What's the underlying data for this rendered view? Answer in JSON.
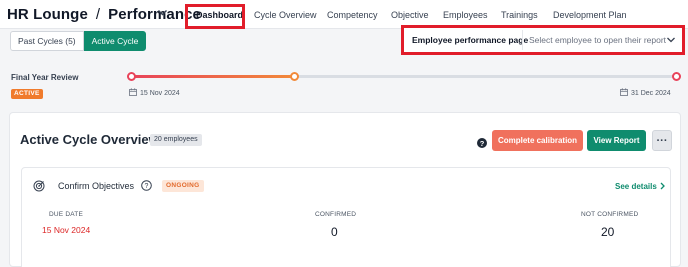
{
  "header": {
    "app": "HR Lounge",
    "section": "Performance",
    "tabs": [
      {
        "label": "Dashboard",
        "active": true
      },
      {
        "label": "Cycle Overview"
      },
      {
        "label": "Competency"
      },
      {
        "label": "Objective"
      },
      {
        "label": "Employees"
      },
      {
        "label": "Trainings"
      },
      {
        "label": "Development Plan"
      }
    ]
  },
  "cycle_toggle": {
    "past": "Past Cycles (5)",
    "active": "Active Cycle"
  },
  "report": {
    "label": "Employee performance page",
    "placeholder": "Select employee to open their report"
  },
  "timeline": {
    "label": "Final Year Review",
    "status": "ACTIVE",
    "start_date": "15 Nov 2024",
    "end_date": "31 Dec 2024",
    "progress": 0.3
  },
  "overview": {
    "title": "Active Cycle Overview",
    "employee_count": "20 employees",
    "calibration_button": "Complete calibration",
    "view_report_button": "View Report",
    "more_button": "···"
  },
  "objectives": {
    "title": "Confirm Objectives",
    "status": "ONGOING",
    "see_details": "See details",
    "due_date_label": "DUE DATE",
    "due_date": "15 Nov 2024",
    "confirmed_label": "CONFIRMED",
    "confirmed": "0",
    "not_confirmed_label": "NOT CONFIRMED",
    "not_confirmed": "20"
  },
  "colors": {
    "primary": "#0f8c6e",
    "accent_orange": "#f0715d",
    "highlight_box": "#e11d2a",
    "timeline_start": "#e8435a",
    "timeline_mid": "#f28a3a"
  }
}
